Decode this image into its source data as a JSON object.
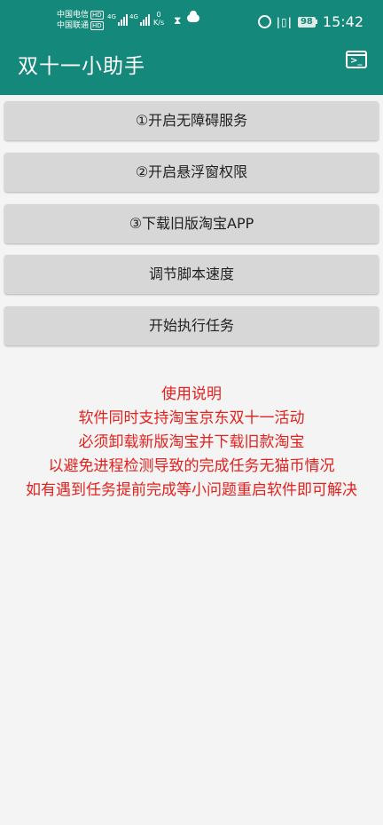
{
  "status_bar": {
    "carrier1": "中国电信",
    "carrier2": "中国联通",
    "hd_badge": "HD",
    "network1": "4G",
    "network2": "4G",
    "speed_value": "0",
    "speed_unit": "K/s",
    "battery": "98",
    "time": "15:42"
  },
  "app_bar": {
    "title": "双十一小助手",
    "terminal_icon": "terminal-icon"
  },
  "buttons": [
    {
      "label": "①开启无障碍服务"
    },
    {
      "label": "②开启悬浮窗权限"
    },
    {
      "label": "③下载旧版淘宝APP"
    },
    {
      "label": "调节脚本速度"
    },
    {
      "label": "开始执行任务"
    }
  ],
  "instructions": {
    "heading": "使用说明",
    "lines": [
      "软件同时支持淘宝京东双十一活动",
      "必须卸载新版淘宝并下载旧款淘宝",
      "以避免进程检测导致的完成任务无猫币情况",
      "如有遇到任务提前完成等小问题重启软件即可解决"
    ]
  },
  "colors": {
    "primary": "#14887a",
    "instruction_text": "#e4211d",
    "button_bg": "#d7d7d7",
    "background": "#f4f4f4"
  }
}
